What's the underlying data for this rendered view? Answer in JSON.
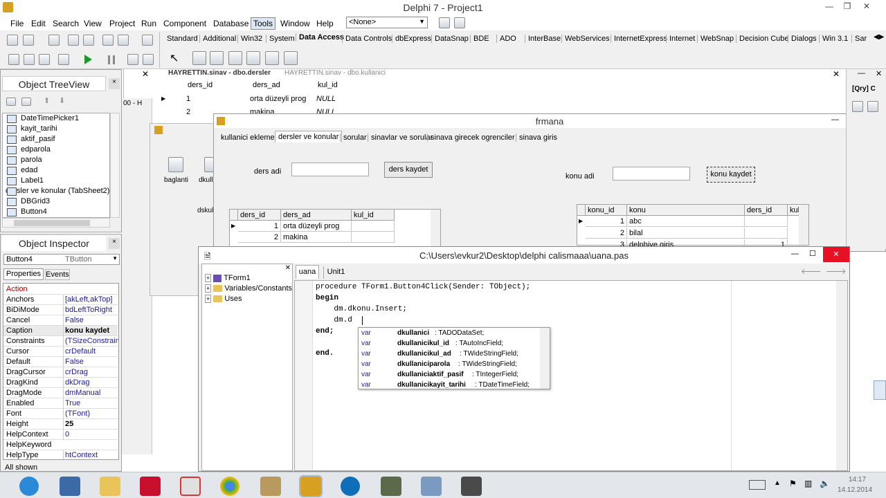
{
  "window": {
    "title": "Delphi 7 - Project1"
  },
  "menu": [
    "File",
    "Edit",
    "Search",
    "View",
    "Project",
    "Run",
    "Component",
    "Database",
    "Tools",
    "Window",
    "Help"
  ],
  "config_select": "<None>",
  "palette_tabs": [
    "Standard",
    "Additional",
    "Win32",
    "System",
    "Data Access",
    "Data Controls",
    "dbExpress",
    "DataSnap",
    "BDE",
    "ADO",
    "InterBase",
    "WebServices",
    "InternetExpress",
    "Internet",
    "WebSnap",
    "Decision Cube",
    "Dialogs",
    "Win 3.1",
    "Sar"
  ],
  "treeview": {
    "title_partial": "Object TreeView",
    "items": [
      "DateTimePicker1",
      "kayit_tarihi",
      "aktif_pasif",
      "edparola",
      "parola",
      "edad",
      "Label1",
      "dersler ve konular (TabSheet2)",
      "DBGrid3",
      "Button4"
    ]
  },
  "inspector": {
    "title": "Object Inspector",
    "object": "Button4",
    "object_type": "TButton",
    "tabs": [
      "Properties",
      "Events"
    ],
    "rows": [
      {
        "name": "Action",
        "value": ""
      },
      {
        "name": "Anchors",
        "value": "[akLeft,akTop]"
      },
      {
        "name": "BiDiMode",
        "value": "bdLeftToRight"
      },
      {
        "name": "Cancel",
        "value": "False"
      },
      {
        "name": "Caption",
        "value": "konu kaydet"
      },
      {
        "name": "Constraints",
        "value": "(TSizeConstrain"
      },
      {
        "name": "Cursor",
        "value": "crDefault"
      },
      {
        "name": "Default",
        "value": "False"
      },
      {
        "name": "DragCursor",
        "value": "crDrag"
      },
      {
        "name": "DragKind",
        "value": "dkDrag"
      },
      {
        "name": "DragMode",
        "value": "dmManual"
      },
      {
        "name": "Enabled",
        "value": "True"
      },
      {
        "name": "Font",
        "value": "(TFont)"
      },
      {
        "name": "Height",
        "value": "25"
      },
      {
        "name": "HelpContext",
        "value": "0"
      },
      {
        "name": "HelpKeyword",
        "value": ""
      },
      {
        "name": "HelpType",
        "value": "htContext"
      }
    ],
    "status": "All shown"
  },
  "bgdata": {
    "tab1": "HAYRETTIN.sinav - dbo.dersler",
    "tab2": "HAYRETTIN.sinav - dbo.kullanici",
    "cols": [
      "ders_id",
      "ders_ad",
      "kul_id"
    ],
    "rows": [
      [
        "1",
        "orta düzeyli prog",
        "NULL"
      ],
      [
        "2",
        "makina",
        "NULL"
      ]
    ]
  },
  "datamodule": {
    "items": [
      "baglanti",
      "dkull",
      "dskul"
    ],
    "partial": "00 - H"
  },
  "form": {
    "title": "frmana",
    "tabs": [
      "kullanici ekleme",
      "dersler ve konular",
      "sorular",
      "sinavlar ve sorular",
      "sinava girecek ogrenciler",
      "sinava giris"
    ],
    "ders_label": "ders adi",
    "ders_button": "ders kaydet",
    "konu_label": "konu adi",
    "konu_button": "konu kaydet",
    "grid1": {
      "cols": [
        "ders_id",
        "ders_ad",
        "kul_id"
      ],
      "rows": [
        [
          "1",
          "orta düzeyli prog",
          ""
        ],
        [
          "2",
          "makina",
          ""
        ]
      ]
    },
    "grid2": {
      "cols": [
        "konu_id",
        "konu",
        "ders_id",
        "kul"
      ],
      "rows": [
        [
          "1",
          "abc",
          ""
        ],
        [
          "2",
          "bilal",
          ""
        ],
        [
          "3",
          "delphiye giris",
          "1"
        ]
      ]
    }
  },
  "editor": {
    "title": "C:\\Users\\evkur2\\Desktop\\delphi calismaaa\\uana.pas",
    "tabs": [
      "uana",
      "Unit1"
    ],
    "explorer": [
      "TForm1",
      "Variables/Constants",
      "Uses"
    ],
    "code": [
      "procedure TForm1.Button4Click(Sender: TObject);",
      "begin",
      "    dm.dkonu.Insert;",
      "    dm.d",
      "end;",
      "",
      "end."
    ],
    "completion": [
      {
        "kind": "var",
        "name": "dkullanici",
        "type": ": TADODataSet;"
      },
      {
        "kind": "var",
        "name": "dkullanicikul_id",
        "type": ": TAutoIncField;"
      },
      {
        "kind": "var",
        "name": "dkullanicikul_ad",
        "type": ": TWideStringField;"
      },
      {
        "kind": "var",
        "name": "dkullaniciparola",
        "type": ": TWideStringField;"
      },
      {
        "kind": "var",
        "name": "dkullaniciaktif_pasif",
        "type": ": TIntegerField;"
      },
      {
        "kind": "var",
        "name": "dkullanicikayit_tarihi",
        "type": ": TDateTimeField;"
      }
    ]
  },
  "right_panel": {
    "label": "[Qry] C"
  },
  "clock": {
    "time": "14:17",
    "date": "14.12.2014"
  }
}
